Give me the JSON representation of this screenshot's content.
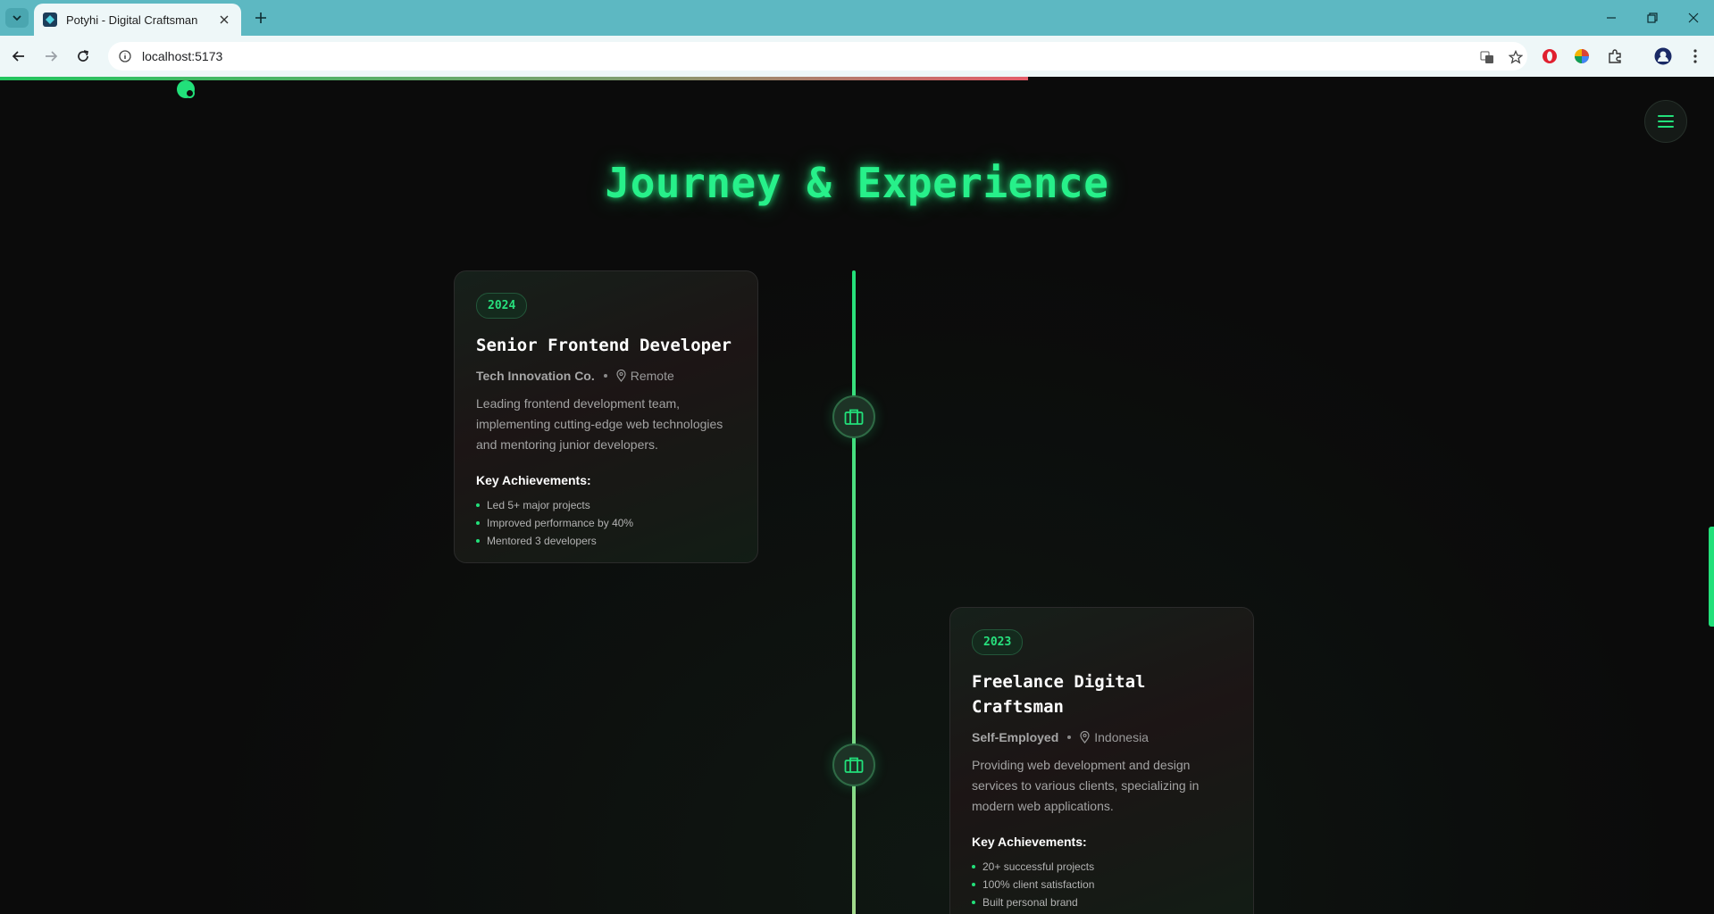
{
  "browser": {
    "tab_title": "Potyhi - Digital Craftsman",
    "url": "localhost:5173"
  },
  "page": {
    "heading": "Journey & Experience",
    "achievements_label": "Key Achievements:",
    "accent_color": "#22e07a",
    "scroll_progress_percent": 60,
    "experiences": [
      {
        "year": "2024",
        "role": "Senior Frontend Developer",
        "company": "Tech Innovation Co.",
        "location": "Remote",
        "description": "Leading frontend development team, implementing cutting-edge web technologies and mentoring junior developers.",
        "achievements": [
          "Led 5+ major projects",
          "Improved performance by 40%",
          "Mentored 3 developers"
        ],
        "icon": "briefcase-icon"
      },
      {
        "year": "2023",
        "role": "Freelance Digital Craftsman",
        "company": "Self-Employed",
        "location": "Indonesia",
        "description": "Providing web development and design services to various clients, specializing in modern web applications.",
        "achievements": [
          "20+ successful projects",
          "100% client satisfaction",
          "Built personal brand"
        ],
        "icon": "briefcase-icon"
      }
    ]
  }
}
